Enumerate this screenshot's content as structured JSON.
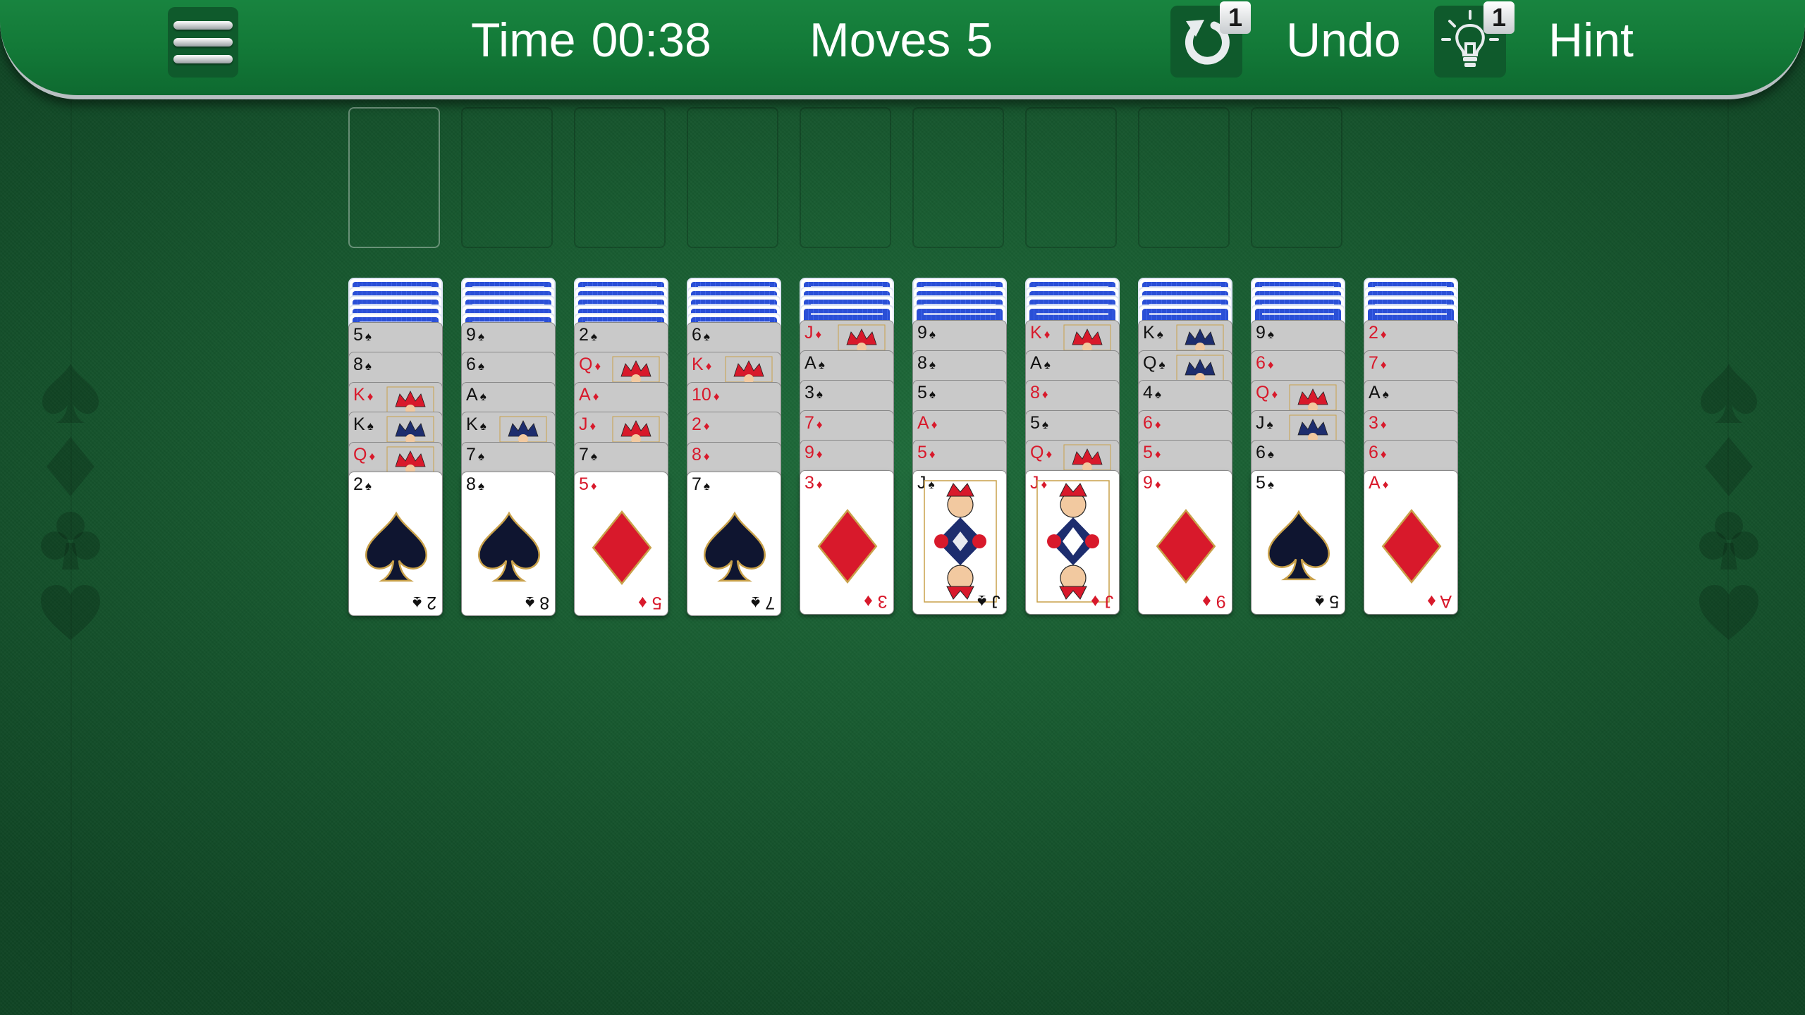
{
  "header": {
    "time_label": "Time",
    "time_value": "00:38",
    "moves_label": "Moves",
    "moves_value": "5",
    "undo_label": "Undo",
    "undo_count": "1",
    "hint_label": "Hint",
    "hint_count": "1"
  },
  "icons": {
    "menu": "menu-icon",
    "undo": "undo-icon",
    "hint": "lightbulb-icon",
    "side_suits": [
      "spade",
      "diamond",
      "club",
      "heart"
    ]
  },
  "colors": {
    "felt": "#175a30",
    "bar": "#137a38",
    "card_back": "#2a4fd6",
    "red_suit": "#d8192b"
  },
  "foundation_slot_count": 9,
  "tableau": [
    {
      "backs": 5,
      "cards": [
        {
          "r": "5",
          "s": "♠"
        },
        {
          "r": "8",
          "s": "♠"
        },
        {
          "r": "K",
          "s": "♦"
        },
        {
          "r": "K",
          "s": "♠"
        },
        {
          "r": "Q",
          "s": "♦"
        },
        {
          "r": "2",
          "s": "♠"
        }
      ]
    },
    {
      "backs": 5,
      "cards": [
        {
          "r": "9",
          "s": "♠"
        },
        {
          "r": "6",
          "s": "♠"
        },
        {
          "r": "A",
          "s": "♠"
        },
        {
          "r": "K",
          "s": "♠"
        },
        {
          "r": "7",
          "s": "♠"
        },
        {
          "r": "8",
          "s": "♠"
        }
      ]
    },
    {
      "backs": 5,
      "cards": [
        {
          "r": "2",
          "s": "♠"
        },
        {
          "r": "Q",
          "s": "♦"
        },
        {
          "r": "A",
          "s": "♦"
        },
        {
          "r": "J",
          "s": "♦"
        },
        {
          "r": "7",
          "s": "♠"
        },
        {
          "r": "5",
          "s": "♦"
        }
      ]
    },
    {
      "backs": 5,
      "cards": [
        {
          "r": "6",
          "s": "♠"
        },
        {
          "r": "K",
          "s": "♦"
        },
        {
          "r": "10",
          "s": "♦"
        },
        {
          "r": "2",
          "s": "♦"
        },
        {
          "r": "8",
          "s": "♦"
        },
        {
          "r": "7",
          "s": "♠"
        }
      ]
    },
    {
      "backs": 4,
      "cards": [
        {
          "r": "J",
          "s": "♦"
        },
        {
          "r": "A",
          "s": "♠"
        },
        {
          "r": "3",
          "s": "♠"
        },
        {
          "r": "7",
          "s": "♦"
        },
        {
          "r": "9",
          "s": "♦"
        },
        {
          "r": "3",
          "s": "♦"
        }
      ]
    },
    {
      "backs": 4,
      "cards": [
        {
          "r": "9",
          "s": "♠"
        },
        {
          "r": "8",
          "s": "♠"
        },
        {
          "r": "5",
          "s": "♠"
        },
        {
          "r": "A",
          "s": "♦"
        },
        {
          "r": "5",
          "s": "♦"
        },
        {
          "r": "J",
          "s": "♠"
        }
      ]
    },
    {
      "backs": 4,
      "cards": [
        {
          "r": "K",
          "s": "♦"
        },
        {
          "r": "A",
          "s": "♠"
        },
        {
          "r": "8",
          "s": "♦"
        },
        {
          "r": "5",
          "s": "♠"
        },
        {
          "r": "Q",
          "s": "♦"
        },
        {
          "r": "J",
          "s": "♦"
        }
      ]
    },
    {
      "backs": 4,
      "cards": [
        {
          "r": "K",
          "s": "♠"
        },
        {
          "r": "Q",
          "s": "♠"
        },
        {
          "r": "4",
          "s": "♠"
        },
        {
          "r": "6",
          "s": "♦"
        },
        {
          "r": "5",
          "s": "♦"
        },
        {
          "r": "9",
          "s": "♦"
        }
      ]
    },
    {
      "backs": 4,
      "cards": [
        {
          "r": "9",
          "s": "♠"
        },
        {
          "r": "6",
          "s": "♦"
        },
        {
          "r": "Q",
          "s": "♦"
        },
        {
          "r": "J",
          "s": "♠"
        },
        {
          "r": "6",
          "s": "♠"
        },
        {
          "r": "5",
          "s": "♠"
        }
      ]
    },
    {
      "backs": 4,
      "cards": [
        {
          "r": "2",
          "s": "♦"
        },
        {
          "r": "7",
          "s": "♦"
        },
        {
          "r": "A",
          "s": "♠"
        },
        {
          "r": "3",
          "s": "♦"
        },
        {
          "r": "6",
          "s": "♦"
        },
        {
          "r": "A",
          "s": "♦"
        }
      ]
    }
  ]
}
